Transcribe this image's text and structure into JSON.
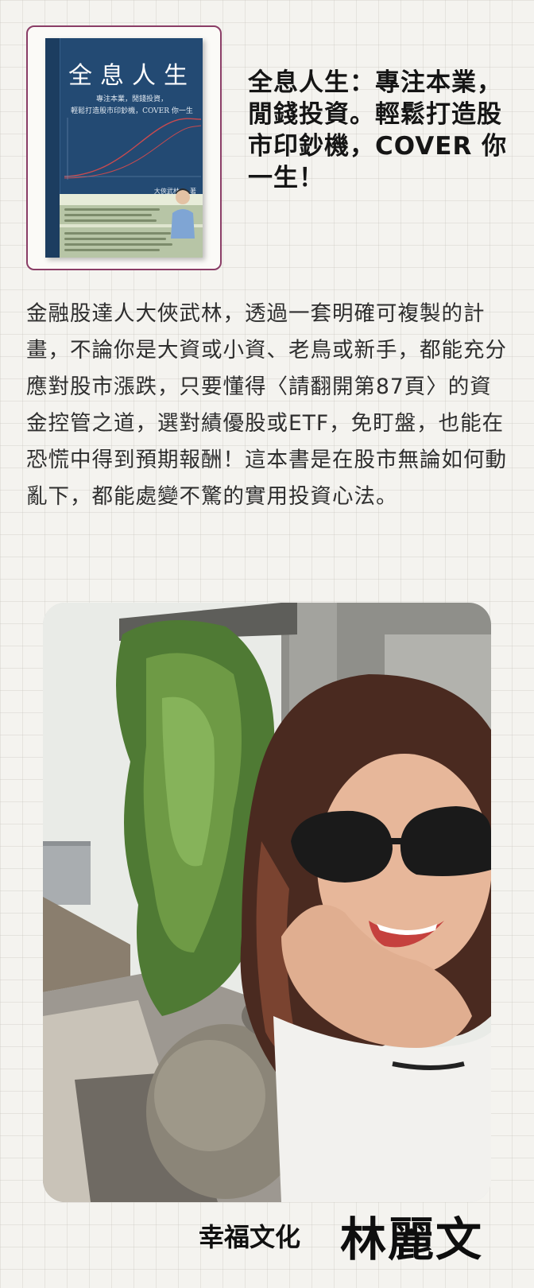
{
  "book": {
    "cover_title": "全息人生",
    "cover_subtitle_line1": "專注本業，閒錢投資，",
    "cover_subtitle_line2": "輕鬆打造股市印鈔機，COVER 你一生",
    "cover_author": "大俠武林 — 著",
    "colors": {
      "cover": "#234a73",
      "band": "#b7c5a6",
      "frame": "#8a3d66",
      "curve": "#c94a4f"
    }
  },
  "headline": "全息人生：專注本業，閒錢投資。輕鬆打造股市印鈔機，COVER 你一生！",
  "description": "金融股達人大俠武林，透過一套明確可複製的計畫，不論你是大資或小資、老鳥或新手，都能充分應對股市漲跌，只要懂得〈請翻開第87頁〉的資金控管之道，選對績優股或ETF，免盯盤，也能在恐慌中得到預期報酬！這本書是在股市無論如何動亂下，都能處變不驚的實用投資心法。",
  "signature": {
    "publisher": "幸福文化",
    "name": "林麗文"
  }
}
